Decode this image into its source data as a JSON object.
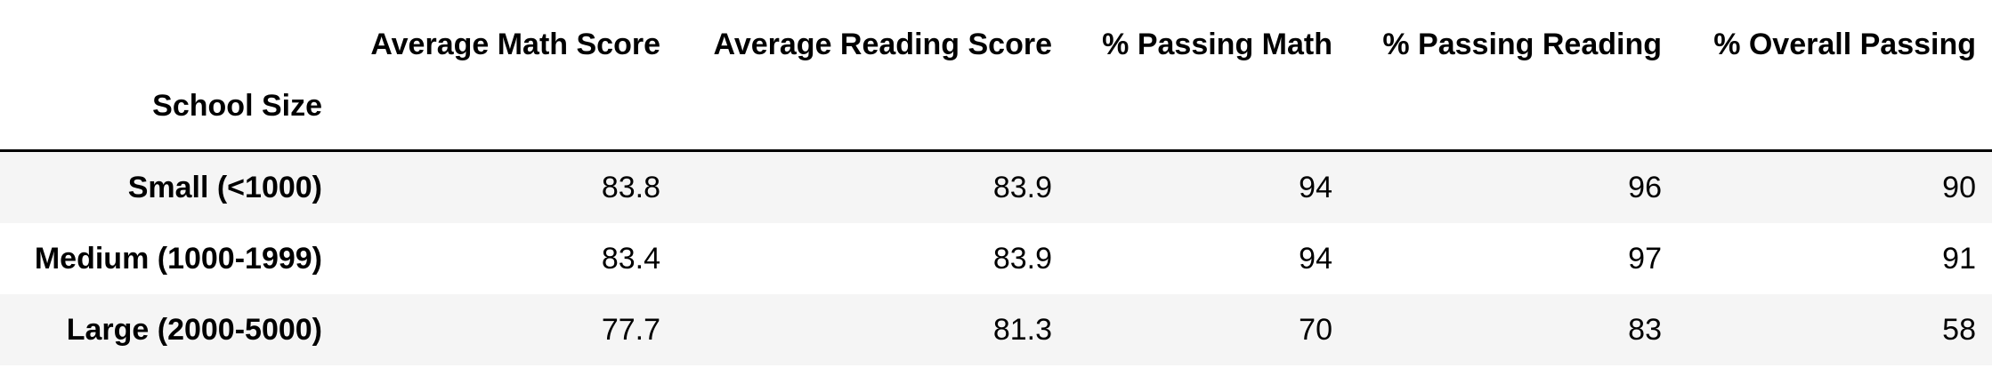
{
  "table": {
    "columns": [
      "Average Math Score",
      "Average Reading Score",
      "% Passing Math",
      "% Passing Reading",
      "% Overall Passing"
    ],
    "index_name": "School Size",
    "rows": [
      {
        "index": "Small (<1000)",
        "values": [
          "83.8",
          "83.9",
          "94",
          "96",
          "90"
        ]
      },
      {
        "index": "Medium (1000-1999)",
        "values": [
          "83.4",
          "83.9",
          "94",
          "97",
          "91"
        ]
      },
      {
        "index": "Large (2000-5000)",
        "values": [
          "77.7",
          "81.3",
          "70",
          "83",
          "58"
        ]
      }
    ]
  },
  "colors": {
    "striped_row": "#f5f5f5",
    "header_rule": "#000000"
  }
}
